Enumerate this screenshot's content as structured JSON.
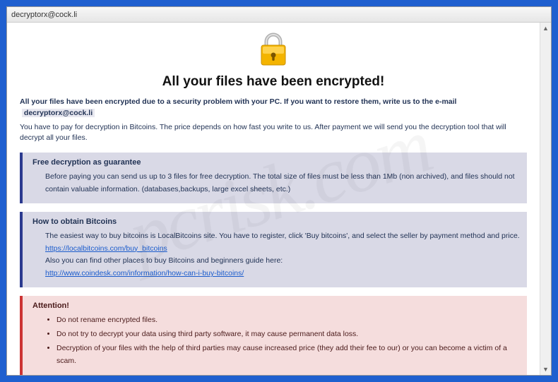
{
  "window_title": "decryptorx@cock.li",
  "heading": "All your files have been encrypted!",
  "intro_bold": "All your files have been encrypted due to a security problem with your PC. If you want to restore them, write us to the e-mail",
  "intro_email": "decryptorx@cock.li",
  "intro_line2": "You have to pay for decryption in Bitcoins. The price depends on how fast you write to us. After payment we will send you the decryption tool that will decrypt all your files.",
  "panel_free": {
    "title": "Free decryption as guarantee",
    "body": "Before paying you can send us up to 3 files for free decryption. The total size of files must be less than 1Mb (non archived), and files should not contain valuable information. (databases,backups, large excel sheets, etc.)"
  },
  "panel_btc": {
    "title": "How to obtain Bitcoins",
    "line1": "The easiest way to buy bitcoins is LocalBitcoins site. You have to register, click 'Buy bitcoins', and select the seller by payment method and price.",
    "link1": "https://localbitcoins.com/buy_bitcoins",
    "line2": "Also you can find other places to buy Bitcoins and beginners guide here:",
    "link2": "http://www.coindesk.com/information/how-can-i-buy-bitcoins/"
  },
  "panel_attn": {
    "title": "Attention!",
    "items": [
      "Do not rename encrypted files.",
      "Do not try to decrypt your data using third party software, it may cause permanent data loss.",
      "Decryption of your files with the help of third parties may cause increased price (they add their fee to our) or you can become a victim of a scam."
    ]
  },
  "watermark": "pcrisk.com"
}
